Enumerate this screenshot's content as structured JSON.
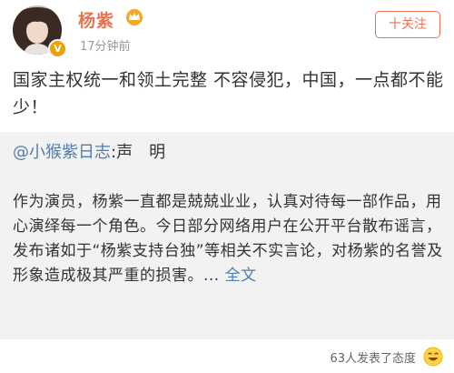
{
  "post": {
    "username": "杨紫",
    "time": "17分钟前",
    "follow_label": "十关注",
    "text": "国家主权统一和领土完整 不容侵犯，中国，一点都不能少！"
  },
  "repost": {
    "author": "@小猴紫日志",
    "title": ":声　明",
    "body": "作为演员，杨紫一直都是兢兢业业，认真对待每一部作品，用心演绎每一个角色。今日部分网络用户在公开平台散布谣言，发布诸如于“杨紫支持台独”等相关不实言论，对杨紫的名誉及形象造成极其严重的损害。... ",
    "read_more": "全文"
  },
  "footer": {
    "reactions": "63人发表了态度"
  },
  "colors": {
    "username": "#eb7350",
    "link": "#507daf",
    "card_bg": "#f2f2f2",
    "badge": "#f0a000"
  },
  "icons": {
    "avatar": "avatar-photo",
    "verified": "vip-badge-icon",
    "member": "crown-icon",
    "reaction": "smile-emoji-icon"
  }
}
